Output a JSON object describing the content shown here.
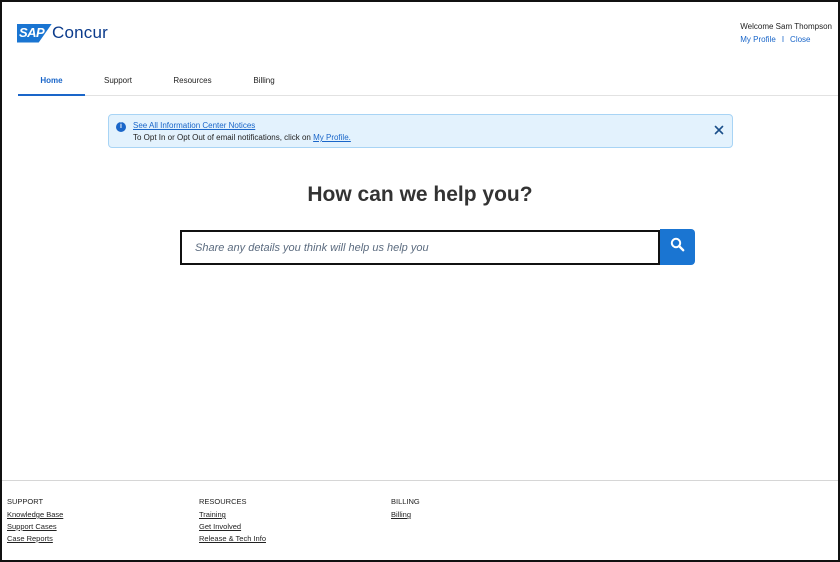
{
  "header": {
    "logo_badge": "SAP",
    "logo_text": "Concur",
    "welcome": "Welcome Sam Thompson",
    "my_profile": "My Profile",
    "separator": "I",
    "close": "Close"
  },
  "nav": {
    "tabs": [
      {
        "label": "Home",
        "active": true
      },
      {
        "label": "Support",
        "active": false
      },
      {
        "label": "Resources",
        "active": false
      },
      {
        "label": "Billing",
        "active": false
      }
    ]
  },
  "notice": {
    "icon": "info-icon",
    "title": "See All Information Center Notices",
    "text": "To Opt In or Opt Out of email notifications, click on",
    "link": "My Profile.",
    "close_icon": "close-icon",
    "background": "#e3f2fd"
  },
  "main": {
    "heading": "How can we help you?",
    "search_placeholder": "Share any details you think will help us help you",
    "search_icon": "search-icon",
    "accent": "#1a75d2"
  },
  "footer": {
    "columns": [
      {
        "title": "SUPPORT",
        "links": [
          "Knowledge Base",
          "Support Cases",
          "Case Reports"
        ]
      },
      {
        "title": "RESOURCES",
        "links": [
          "Training",
          "Get Involved",
          "Release & Tech Info"
        ]
      },
      {
        "title": "BILLING",
        "links": [
          "Billing"
        ]
      }
    ]
  }
}
